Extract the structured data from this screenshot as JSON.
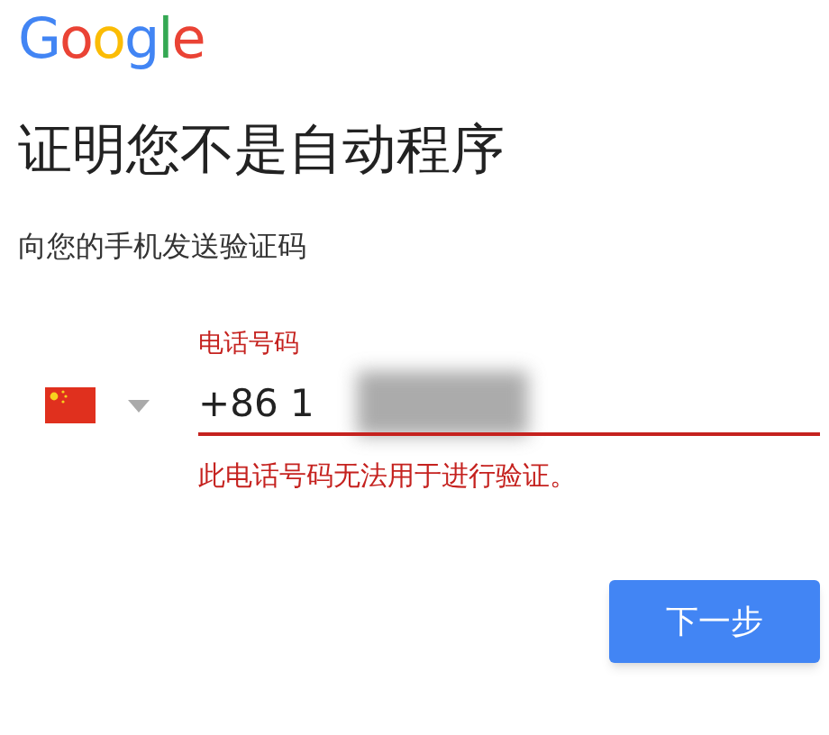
{
  "logo": "Google",
  "title": "证明您不是自动程序",
  "subtitle": "向您的手机发送验证码",
  "phone_field": {
    "label": "电话号码",
    "value": "+86 1",
    "error": true,
    "error_message": "此电话号码无法用于进行验证。"
  },
  "buttons": [
    {
      "label": "下一步"
    }
  ]
}
